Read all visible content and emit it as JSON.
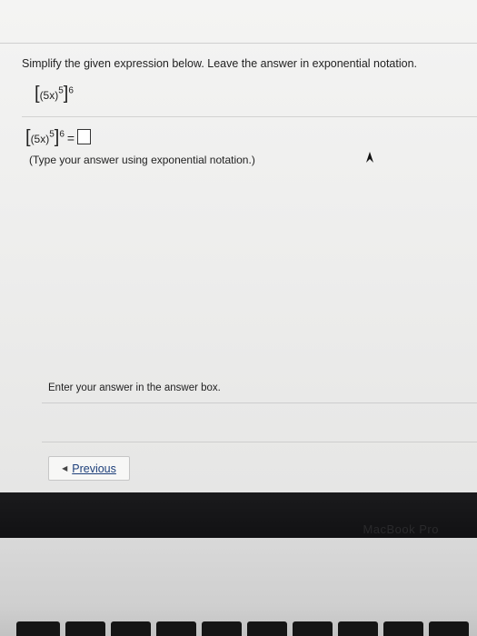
{
  "question": {
    "prompt": "Simplify the given expression below. Leave the answer in exponential notation.",
    "expression": {
      "open": "[",
      "base": "(5x)",
      "inner_exponent": "5",
      "close": "]",
      "outer_exponent": "6"
    },
    "answer_line": {
      "equals": "=",
      "answer_value": ""
    },
    "hint": "(Type your answer using exponential notation.)"
  },
  "footer": {
    "status": "Enter your answer in the answer box.",
    "previous_label": "Previous"
  },
  "device": {
    "brand": "MacBook Pro"
  },
  "colors": {
    "link": "#1d3f7a",
    "background": "#f0f0ef"
  }
}
